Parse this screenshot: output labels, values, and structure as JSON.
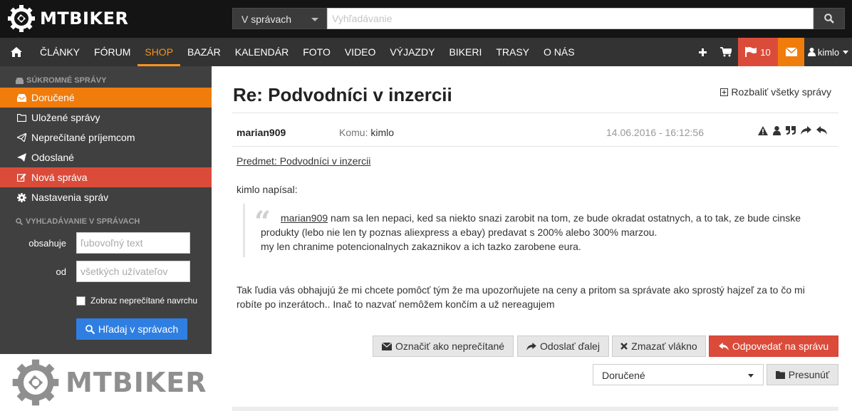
{
  "brand": {
    "name": "MTBIKER"
  },
  "search": {
    "scope": "V správach",
    "placeholder": "Vyhľadávanie"
  },
  "nav": {
    "items": [
      "ČLÁNKY",
      "FÓRUM",
      "SHOP",
      "BAZÁR",
      "KALENDÁR",
      "FOTO",
      "VIDEO",
      "VÝJAZDY",
      "BIKERI",
      "TRASY",
      "O NÁS"
    ],
    "active": "SHOP",
    "notifications_count": "10",
    "username": "kimlo"
  },
  "sidebar": {
    "section_title": "SÚKROMNÉ SPRÁVY",
    "items": [
      {
        "label": "Doručené",
        "state": "active"
      },
      {
        "label": "Uložené správy"
      },
      {
        "label": "Neprečítané príjemcom"
      },
      {
        "label": "Odoslané"
      },
      {
        "label": "Nová správa",
        "state": "highlight"
      },
      {
        "label": "Nastavenia správ"
      }
    ],
    "search_title": "VYHĽADÁVANIE V SPRÁVACH",
    "contains_label": "obsahuje",
    "contains_placeholder": "ľubovoľný text",
    "from_label": "od",
    "from_placeholder": "všetkých užívateľov",
    "unread_first_label": "Zobraz neprečítané navrchu",
    "search_button": "Hľadaj v správach"
  },
  "message": {
    "title": "Re: Podvodníci v inzercii",
    "expand_all": "Rozbaliť všetky správy",
    "sender": "marian909",
    "to_label": "Komu:",
    "to_user": "kimlo",
    "date": "14.06.2016 - 16:12:56",
    "subject": "Predmet: Podvodníci v inzercii",
    "quote_intro": "kimlo napísal:",
    "quote_user": "marian909",
    "quote_line1": " nam sa len nepaci, ked sa niekto snazi zarobit na tom, ze bude okradat ostatnych, a to tak, ze bude cinske produkty (lebo nie len ty poznas aliexpress a ebay) predavat s 200% alebo 300% marzou.",
    "quote_line2": "my len chranime potencionalnych zakaznikov a ich tazko zarobene eura.",
    "body": "Tak ľudia vás obhajujú že mi chcete pomôcť tým že ma upozorňujete na ceny a pritom sa správate ako sprostý hajzeľ za to čo mi robíte po inzerátoch.. Inač to nazvať nemôžem končím a už nereagujem"
  },
  "actions": {
    "mark_unread": "Označiť ako neprečítané",
    "forward": "Odoslať ďalej",
    "delete_thread": "Zmazať vlákno",
    "reply": "Odpovedať na správu",
    "folder": "Doručené",
    "move": "Presunúť"
  },
  "colors": {
    "accent_orange": "#f07c0c",
    "danger_red": "#db4b3a",
    "primary_blue": "#2f7fe2",
    "nav_bg": "#333333",
    "top_bg": "#141414",
    "sidebar_bg": "#404040"
  }
}
